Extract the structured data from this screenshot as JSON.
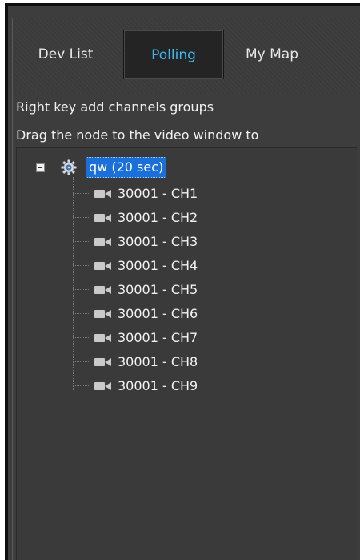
{
  "tabs": [
    {
      "label": "Dev List"
    },
    {
      "label": "Polling",
      "active": true
    },
    {
      "label": "My Map"
    }
  ],
  "hints": {
    "line1": "Right key add channels groups",
    "line2": "Drag the node to the video window to"
  },
  "tree": {
    "group": {
      "label": "qw (20 sec)",
      "icon": "gear-icon",
      "expanded": true,
      "selected": true
    },
    "channels": [
      {
        "label": "30001 - CH1",
        "icon": "camera-icon"
      },
      {
        "label": "30001 - CH2",
        "icon": "camera-icon"
      },
      {
        "label": "30001 - CH3",
        "icon": "camera-icon"
      },
      {
        "label": "30001 - CH4",
        "icon": "camera-icon"
      },
      {
        "label": "30001 - CH5",
        "icon": "camera-icon"
      },
      {
        "label": "30001 - CH6",
        "icon": "camera-icon"
      },
      {
        "label": "30001 - CH7",
        "icon": "camera-icon"
      },
      {
        "label": "30001 - CH8",
        "icon": "camera-icon"
      },
      {
        "label": "30001 - CH9",
        "icon": "camera-icon"
      }
    ]
  },
  "colors": {
    "active_tab_text": "#3eb8ee",
    "selection": "#1a6fd8",
    "panel_bg": "#3a3a3a"
  }
}
